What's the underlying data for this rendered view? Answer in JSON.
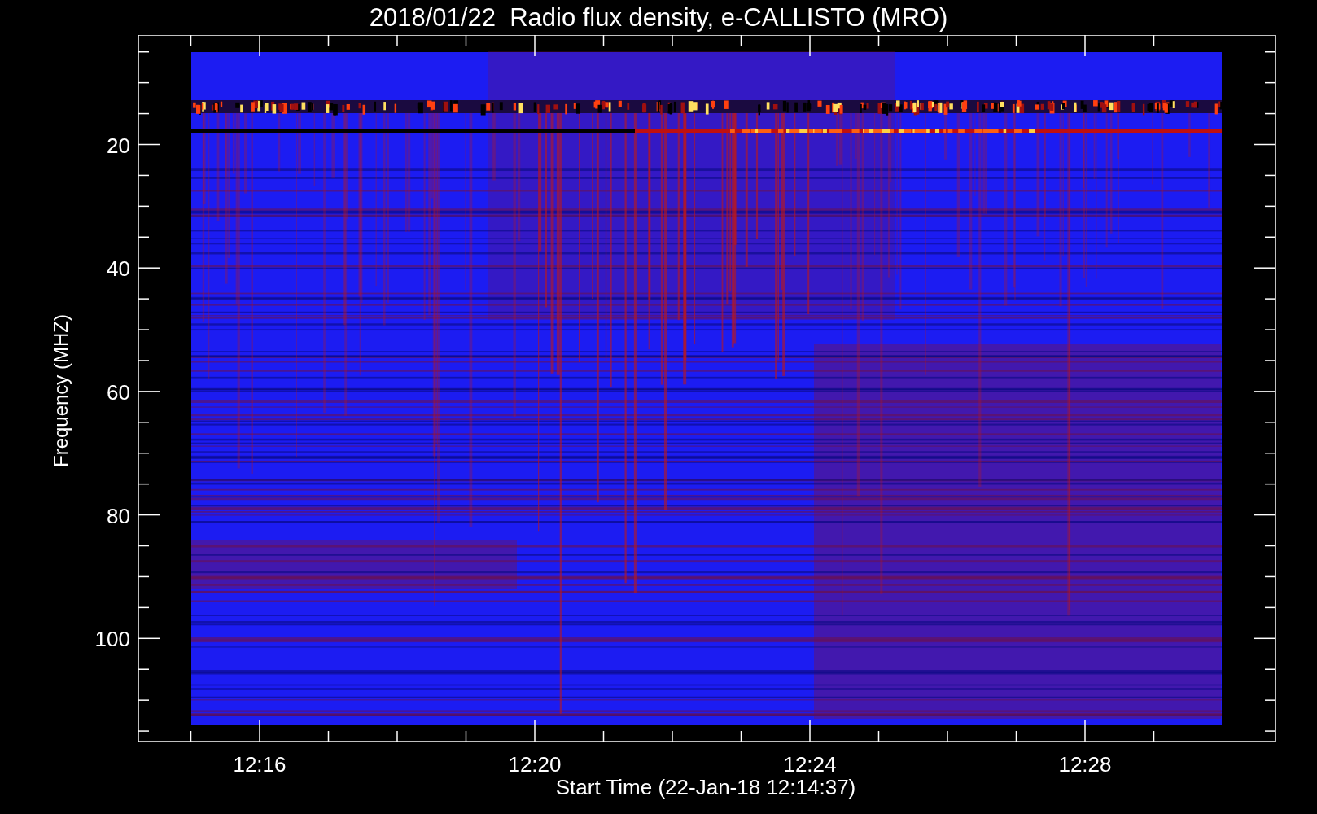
{
  "title": "2018/01/22  Radio flux density, e-CALLISTO (MRO)",
  "plot": {
    "ylabel": "Frequency (MHZ)",
    "xlabel": "Start Time (22-Jan-18 12:14:37)",
    "yticks": [
      "20",
      "40",
      "60",
      "80",
      "100"
    ],
    "xticks": [
      "12:16",
      "12:20",
      "12:24",
      "12:28"
    ]
  }
}
